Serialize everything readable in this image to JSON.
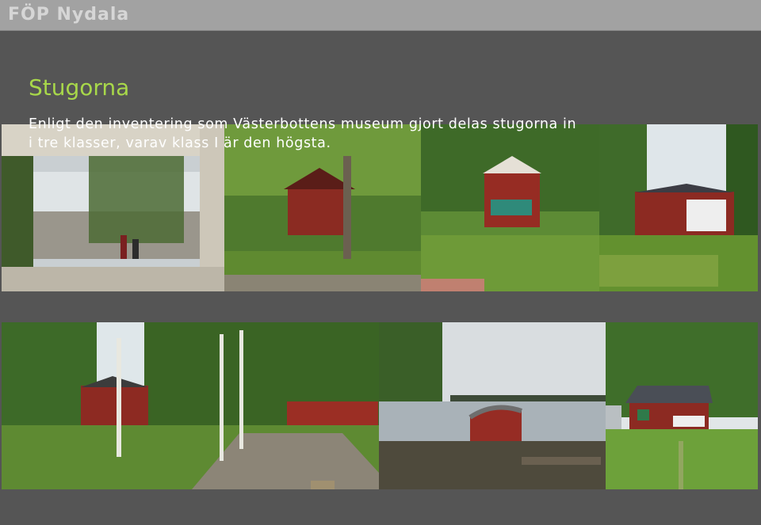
{
  "header": {
    "brand": "FÖP Nydala"
  },
  "slide": {
    "title": "Stugorna",
    "body_line1": "Enligt den inventering som Västerbottens museum gjort delas stugorna in",
    "body_line2": "i tre klasser, varav klass I är den högsta."
  },
  "colors": {
    "background": "#555555",
    "header": "#a2a2a2",
    "brand_text": "#d6d6d6",
    "title": "#a8d84a",
    "body_text": "#ffffff"
  }
}
